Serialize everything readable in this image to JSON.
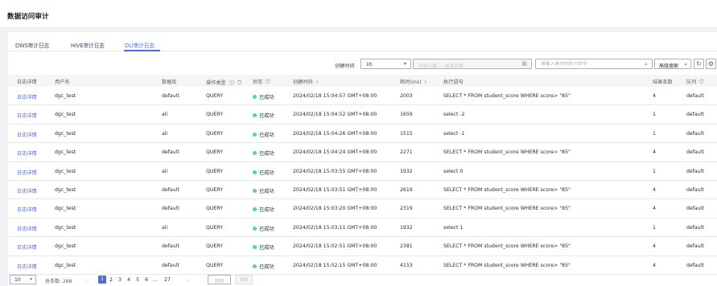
{
  "page": {
    "title": "数据访问审计"
  },
  "tabs": [
    {
      "label": "DWS审计日志",
      "active": false
    },
    {
      "label": "HIVE审计日志",
      "active": false
    },
    {
      "label": "DLI审计日志",
      "active": true
    }
  ],
  "filters": {
    "time_label": "创建时间",
    "time_value": "1h",
    "date_placeholder": "开始日期 — 结束日期",
    "search_placeholder": "请输入操作的执行命令",
    "advanced_label": "高级搜索"
  },
  "table": {
    "columns": [
      "日志详情",
      "用户名",
      "数据库",
      "操作类型",
      "状态",
      "创建时间",
      "耗时(ms)",
      "执行语句",
      "结果条数",
      "队列"
    ],
    "rows": [
      {
        "detail": "日志详情",
        "user": "dgc_test",
        "db": "default",
        "op": "QUERY",
        "status": "已成功",
        "time": "2024/02/18 15:04:57 GMT+08:00",
        "cost": "2003",
        "stmt": "SELECT * FROM student_score WHERE score> \"85\"",
        "count": "4",
        "queue": "default"
      },
      {
        "detail": "日志详情",
        "user": "dgc_test",
        "db": "ali",
        "op": "QUERY",
        "status": "已成功",
        "time": "2024/02/18 15:04:52 GMT+08:00",
        "cost": "1659",
        "stmt": "select -2",
        "count": "1",
        "queue": "default"
      },
      {
        "detail": "日志详情",
        "user": "dgc_test",
        "db": "ali",
        "op": "QUERY",
        "status": "已成功",
        "time": "2024/02/18 15:04:26 GMT+08:00",
        "cost": "1515",
        "stmt": "select -1",
        "count": "1",
        "queue": "default"
      },
      {
        "detail": "日志详情",
        "user": "dgc_test",
        "db": "default",
        "op": "QUERY",
        "status": "已成功",
        "time": "2024/02/18 15:04:24 GMT+08:00",
        "cost": "2271",
        "stmt": "SELECT * FROM student_score WHERE score> \"85\"",
        "count": "4",
        "queue": "default"
      },
      {
        "detail": "日志详情",
        "user": "dgc_test",
        "db": "ali",
        "op": "QUERY",
        "status": "已成功",
        "time": "2024/02/18 15:03:55 GMT+08:00",
        "cost": "1932",
        "stmt": "select 0",
        "count": "1",
        "queue": "default"
      },
      {
        "detail": "日志详情",
        "user": "dgc_test",
        "db": "default",
        "op": "QUERY",
        "status": "已成功",
        "time": "2024/02/18 15:03:51 GMT+08:00",
        "cost": "2619",
        "stmt": "SELECT * FROM student_score WHERE score> \"85\"",
        "count": "4",
        "queue": "default"
      },
      {
        "detail": "日志详情",
        "user": "dgc_test",
        "db": "default",
        "op": "QUERY",
        "status": "已成功",
        "time": "2024/02/18 15:03:20 GMT+08:00",
        "cost": "2319",
        "stmt": "SELECT * FROM student_score WHERE score> \"85\"",
        "count": "4",
        "queue": "default"
      },
      {
        "detail": "日志详情",
        "user": "dgc_test",
        "db": "ali",
        "op": "QUERY",
        "status": "已成功",
        "time": "2024/02/18 15:03:11 GMT+08:00",
        "cost": "1932",
        "stmt": "select 1",
        "count": "1",
        "queue": "default"
      },
      {
        "detail": "日志详情",
        "user": "dgc_test",
        "db": "default",
        "op": "QUERY",
        "status": "已成功",
        "time": "2024/02/18 15:02:51 GMT+08:00",
        "cost": "2381",
        "stmt": "SELECT * FROM student_score WHERE score> \"85\"",
        "count": "4",
        "queue": "default"
      },
      {
        "detail": "日志详情",
        "user": "dgc_test",
        "db": "default",
        "op": "QUERY",
        "status": "已成功",
        "time": "2024/02/18 15:02:15 GMT+08:00",
        "cost": "4153",
        "stmt": "SELECT * FROM student_score WHERE score> \"85\"",
        "count": "4",
        "queue": "default"
      }
    ]
  },
  "pagination": {
    "page_size": "10",
    "total_text": "总条数: 268",
    "pages": [
      "1",
      "2",
      "3",
      "4",
      "5",
      "6",
      "...",
      "27"
    ],
    "current": "1",
    "jump_placeholder": "页码",
    "go_label": "GO"
  },
  "colors": {
    "accent": "#526ecc",
    "success": "#50d4ab"
  }
}
